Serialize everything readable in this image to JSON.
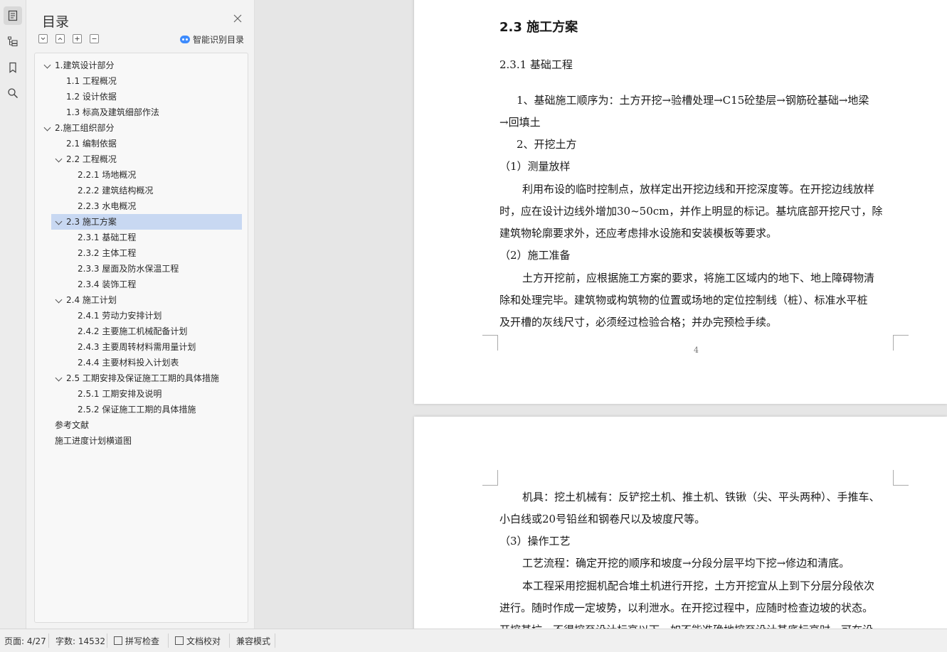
{
  "toc_panel": {
    "title": "目录",
    "smart_toc_label": "智能识别目录",
    "items": [
      {
        "label": "1.建筑设计部分"
      },
      {
        "label": "1.1 工程概况"
      },
      {
        "label": "1.2 设计依据"
      },
      {
        "label": "1.3 标高及建筑细部作法"
      },
      {
        "label": "2.施工组织部分"
      },
      {
        "label": "2.1 编制依据"
      },
      {
        "label": "2.2 工程概况"
      },
      {
        "label": "2.2.1 场地概况"
      },
      {
        "label": "2.2.2 建筑结构概况"
      },
      {
        "label": "2.2.3 水电概况"
      },
      {
        "label": "2.3 施工方案"
      },
      {
        "label": "2.3.1 基础工程"
      },
      {
        "label": "2.3.2 主体工程"
      },
      {
        "label": "2.3.3 屋面及防水保温工程"
      },
      {
        "label": "2.3.4 装饰工程"
      },
      {
        "label": "2.4 施工计划"
      },
      {
        "label": "2.4.1  劳动力安排计划"
      },
      {
        "label": "2.4.2  主要施工机械配备计划"
      },
      {
        "label": "2.4.3  主要周转材料需用量计划"
      },
      {
        "label": "2.4.4  主要材料投入计划表"
      },
      {
        "label": "2.5 工期安排及保证施工工期的具体措施"
      },
      {
        "label": "2.5.1 工期安排及说明"
      },
      {
        "label": "2.5.2  保证施工工期的具体措施"
      },
      {
        "label": "参考文献"
      },
      {
        "label": "施工进度计划横道图"
      }
    ],
    "selected_item": "2.3 施工方案"
  },
  "document": {
    "page1": {
      "heading": "2.3 施工方案",
      "subheading": "2.3.1 基础工程",
      "lines": [
        "1、基础施工顺序为：土方开挖→验槽处理→C15砼垫层→钢筋砼基础→地梁",
        "→回填土",
        "2、开挖土方",
        "（1）测量放样",
        "利用布设的临时控制点，放样定出开挖边线和开挖深度等。在开挖边线放样",
        "时，应在设计边线外增加30~50cm，并作上明显的标记。基坑底部开挖尺寸，除",
        "建筑物轮廓要求外，还应考虑排水设施和安装模板等要求。",
        "（2）施工准备",
        "土方开挖前，应根据施工方案的要求，将施工区域内的地下、地上障碍物清",
        "除和处理完毕。建筑物或构筑物的位置或场地的定位控制线（桩）、标准水平桩",
        "及开槽的灰线尺寸，必须经过检验合格；并办完预检手续。"
      ],
      "page_number": "4"
    },
    "page2": {
      "lines": [
        "机具：挖土机械有：反铲挖土机、推土机、铁锹（尖、平头两种）、手推车、",
        "小白线或20号铅丝和钢卷尺以及坡度尺等。",
        "（3）操作工艺",
        "工艺流程：确定开挖的顺序和坡度→分段分层平均下挖→修边和清底。",
        "本工程采用挖掘机配合堆土机进行开挖，土方开挖宜从上到下分层分段依次",
        "进行。随时作成一定坡势，以利泄水。在开挖过程中，应随时检查边坡的状态。",
        "开挖基坑，不得挖至设计标高以下，如不能准确地挖至设计基底标高时，可在设"
      ]
    }
  },
  "status_bar": {
    "page": "页面: 4/27",
    "word_count": "字数: 14532",
    "spell_check": "拼写检查",
    "doc_proof": "文档校对",
    "compat_mode": "兼容模式"
  },
  "colors": {
    "selected_bg": "#c8d8f2",
    "smart_icon": "#3d8bfd"
  }
}
